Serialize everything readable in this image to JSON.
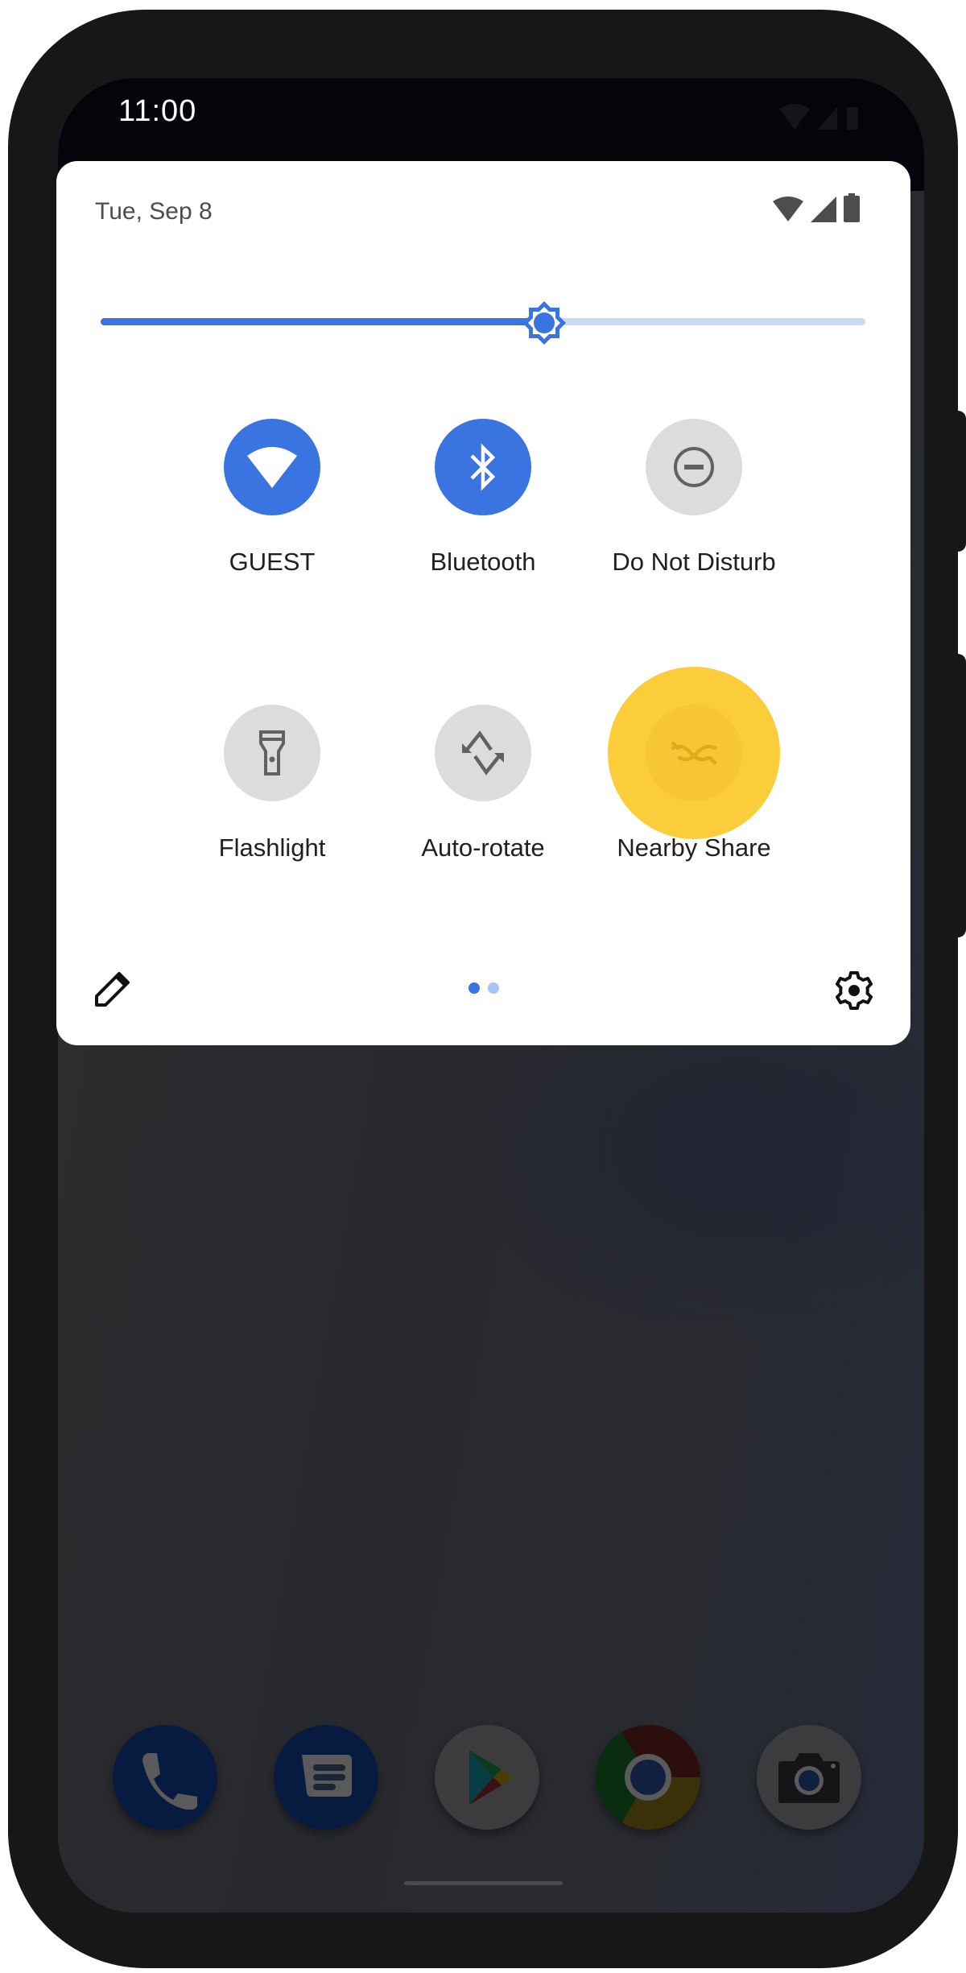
{
  "status_bar": {
    "time": "11:00",
    "icons": [
      "wifi-icon",
      "cellular-signal-icon",
      "battery-icon"
    ]
  },
  "quick_settings": {
    "date": "Tue, Sep 8",
    "header_icons": [
      "wifi-icon",
      "cellular-signal-icon",
      "battery-icon"
    ],
    "brightness": {
      "label": "Brightness",
      "value_percent": 58,
      "icon": "brightness-icon"
    },
    "tiles": [
      {
        "id": "wifi",
        "label": "GUEST",
        "icon": "wifi-icon",
        "state": "on"
      },
      {
        "id": "bluetooth",
        "label": "Bluetooth",
        "icon": "bluetooth-icon",
        "state": "on"
      },
      {
        "id": "dnd",
        "label": "Do Not Disturb",
        "icon": "do-not-disturb-icon",
        "state": "off"
      },
      {
        "id": "flashlight",
        "label": "Flashlight",
        "icon": "flashlight-icon",
        "state": "off"
      },
      {
        "id": "autorotate",
        "label": "Auto-rotate",
        "icon": "auto-rotate-icon",
        "state": "off"
      },
      {
        "id": "nearby",
        "label": "Nearby Share",
        "icon": "nearby-share-icon",
        "state": "highlighted"
      }
    ],
    "footer": {
      "edit_icon": "pencil-icon",
      "settings_icon": "gear-icon",
      "pages": 2,
      "current_page": 1
    }
  },
  "dock": {
    "apps": [
      {
        "name": "Phone",
        "icon": "phone-icon"
      },
      {
        "name": "Messages",
        "icon": "messages-icon"
      },
      {
        "name": "Play Store",
        "icon": "play-store-icon"
      },
      {
        "name": "Chrome",
        "icon": "chrome-icon"
      },
      {
        "name": "Camera",
        "icon": "camera-icon"
      }
    ]
  },
  "colors": {
    "accent": "#3a74e0",
    "accent_light": "#c8dbf5",
    "tile_off": "#dcdcdc",
    "highlight": "#fccd3b",
    "frame": "#171717"
  }
}
